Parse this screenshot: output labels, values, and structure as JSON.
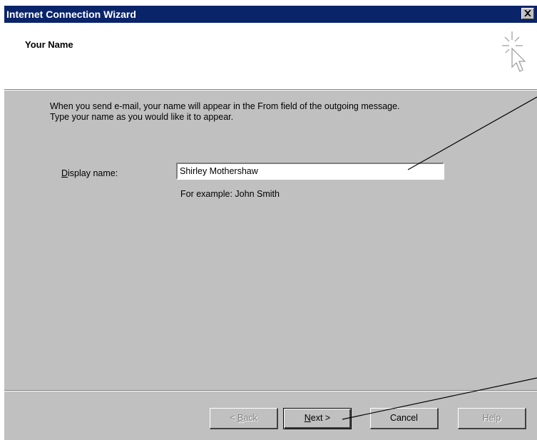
{
  "window": {
    "title": "Internet Connection Wizard",
    "close_symbol": "close-icon"
  },
  "header": {
    "title": "Your Name",
    "icon": "wizard-cursor-icon"
  },
  "body": {
    "intro_line1": "When you send e-mail, your name will appear in the From field of the outgoing message.",
    "intro_line2": "Type your name as you would like it to appear.",
    "display_name_label_accel": "D",
    "display_name_label_rest": "isplay name:",
    "display_name_value": "Shirley Mothershaw",
    "example_text": "For example: John Smith"
  },
  "buttons": {
    "back_prefix": "< ",
    "back_accel": "B",
    "back_rest": "ack",
    "next_accel": "N",
    "next_rest": "ext >",
    "cancel": "Cancel",
    "help": "Help"
  },
  "colors": {
    "titlebar": "#0a246a",
    "face": "#c0c0c0",
    "header": "#ffffff"
  }
}
